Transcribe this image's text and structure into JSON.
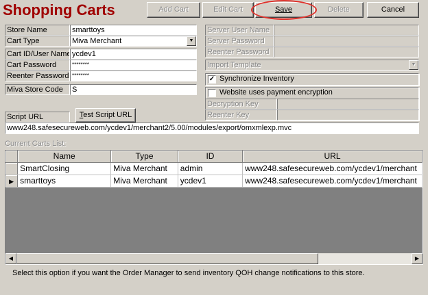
{
  "header": {
    "title": "Shopping Carts"
  },
  "toolbar": {
    "add_cart": "Add Cart",
    "edit_cart": "Edit Cart",
    "save": "Save",
    "delete": "Delete",
    "cancel": "Cancel"
  },
  "form": {
    "store_name_label": "Store Name",
    "store_name_value": "smarttoys",
    "cart_type_label": "Cart Type",
    "cart_type_value": "Miva Merchant",
    "cart_id_label": "Cart ID/User Name",
    "cart_id_value": "ycdev1",
    "cart_password_label": "Cart Password",
    "cart_password_value": "********",
    "reenter_password_label": "Reenter Password",
    "reenter_password_value": "********",
    "miva_store_code_label": "Miva Store Code",
    "miva_store_code_value": "S",
    "script_url_label": "Script URL",
    "test_script_url": "Test Script URL",
    "script_url_value": "www248.safesecureweb.com/ycdev1/merchant2/5.00/modules/export/omxmlexp.mvc"
  },
  "server": {
    "server_user_name_label": "Server User Name",
    "server_password_label": "Server Password",
    "reenter_password_label": "Reenter Password",
    "import_template_label": "Import Template",
    "sync_inventory_label": "Synchronize Inventory",
    "sync_inventory_checked": true,
    "payment_encryption_label": "Website uses payment encryption",
    "payment_encryption_checked": false,
    "decryption_key_label": "Decryption Key",
    "reenter_key_label": "Reenter Key"
  },
  "grid": {
    "caption": "Current Carts List:",
    "columns": [
      "Name",
      "Type",
      "ID",
      "URL"
    ],
    "rows": [
      {
        "name": "SmartClosing",
        "type": "Miva Merchant",
        "id": "admin",
        "url": "www248.safesecureweb.com/ycdev1/merchant",
        "selected": false
      },
      {
        "name": "smarttoys",
        "type": "Miva Merchant",
        "id": "ycdev1",
        "url": "www248.safesecureweb.com/ycdev1/merchant",
        "selected": true
      }
    ]
  },
  "status": {
    "text": "Select this option if you want the Order Manager to send inventory QOH change notifications to this store."
  }
}
